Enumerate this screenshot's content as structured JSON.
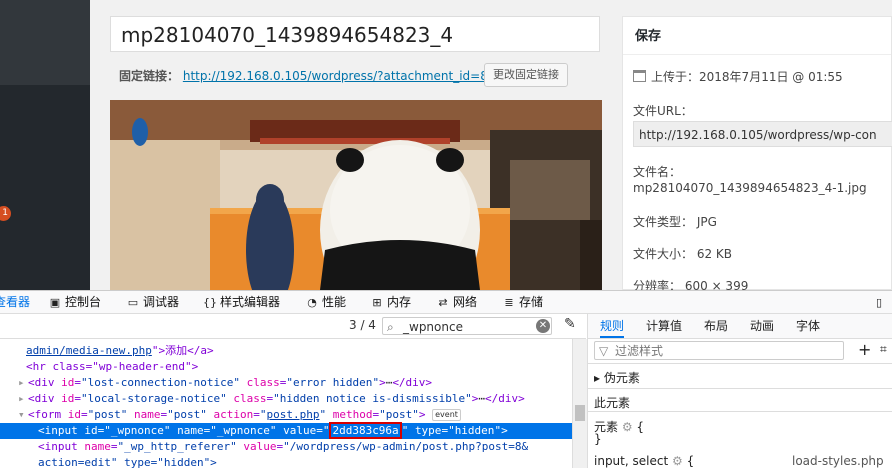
{
  "editor": {
    "title_value": "mp28104070_1439894654823_4",
    "permalink_label": "固定链接：",
    "permalink_url": "http://192.168.0.105/wordpress/?attachment_id=8",
    "change_permalink_button": "更改固定链接"
  },
  "sidebar": {
    "badge_count": "1"
  },
  "savebox": {
    "heading": "保存",
    "uploaded_label": "上传于：",
    "uploaded_value": "2018年7月11日 @ 01:55",
    "file_url_label": "文件URL：",
    "file_url_value": "http://192.168.0.105/wordpress/wp-con",
    "file_name_label": "文件名：",
    "file_name_value": "mp28104070_1439894654823_4-1.jpg",
    "file_type_label": "文件类型：",
    "file_type_value": "JPG",
    "file_size_label": "文件大小：",
    "file_size_value": "62 KB",
    "resolution_label": "分辨率：",
    "resolution_value": "600 × 399"
  },
  "devtools": {
    "tabs": [
      "查看器",
      "控制台",
      "调试器",
      "样式编辑器",
      "性能",
      "内存",
      "网络",
      "存储"
    ],
    "search": {
      "match_count": "3 / 4",
      "query": "_wpnonce"
    },
    "dom": {
      "line1_a": "admin/media-new.php",
      "line1_b": "\">添加</a>",
      "line2": "<hr class=\"wp-header-end\">",
      "line3_id": "lost-connection-notice",
      "line3_class": "error hidden",
      "line4_id": "local-storage-notice",
      "line4_class": "hidden notice is-dismissible",
      "line5_id": "post",
      "line5_name": "post",
      "line5_action": "post.php",
      "line5_method": "post",
      "event_badge": "event",
      "line6_id": "_wpnonce",
      "line6_name": "_wpnonce",
      "line6_value": "2dd383c96a",
      "line6_type": "hidden",
      "line7_name": "_wp_http_referer",
      "line7_value": "/wordpress/wp-admin/post.php?post=8&",
      "line8": "action=edit\" type=\"hidden\">"
    },
    "rules_tabs": [
      "规则",
      "计算值",
      "布局",
      "动画",
      "字体"
    ],
    "filter_placeholder": "过滤样式",
    "pseudo_elements": "伪元素",
    "this_element": "此元素",
    "element_rule": "元素",
    "last_line": "input, select",
    "last_line_source": "load-styles.php"
  }
}
